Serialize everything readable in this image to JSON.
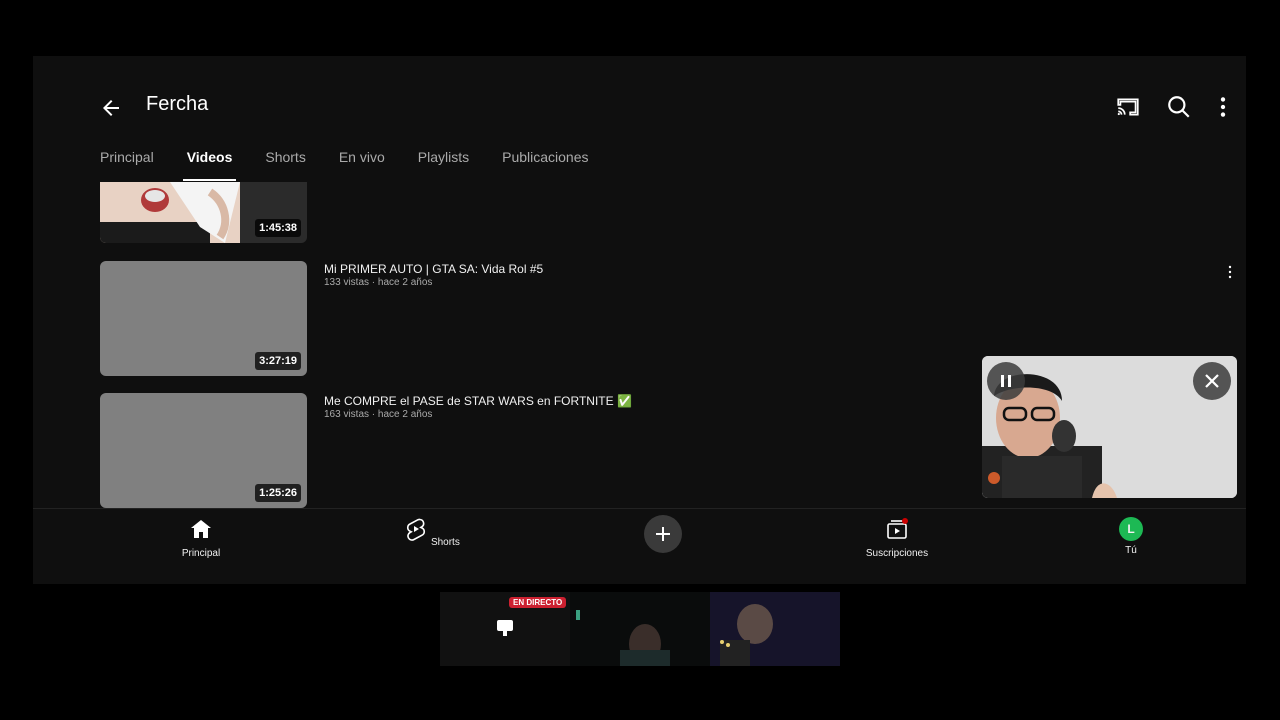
{
  "channel": {
    "name": "Fercha"
  },
  "tabs": [
    {
      "label": "Principal",
      "active": false
    },
    {
      "label": "Videos",
      "active": true
    },
    {
      "label": "Shorts",
      "active": false
    },
    {
      "label": "En vivo",
      "active": false
    },
    {
      "label": "Playlists",
      "active": false
    },
    {
      "label": "Publicaciones",
      "active": false
    }
  ],
  "videos": [
    {
      "duration": "1:45:38"
    },
    {
      "title": "Mi PRIMER AUTO | GTA SA: Vida Rol #5",
      "meta": "133 vistas · hace 2 años",
      "duration": "3:27:19"
    },
    {
      "title": "Me COMPRE el PASE de STAR WARS en FORTNITE ✅",
      "meta": "163 vistas · hace 2 años",
      "duration": "1:25:26"
    }
  ],
  "nav": {
    "home": "Principal",
    "shorts": "Shorts",
    "subs": "Suscripciones",
    "you": "Tú",
    "avatar_letter": "L"
  },
  "overlay": {
    "live_badge": "EN DIRECTO"
  },
  "colors": {
    "accent_live": "#cc0000",
    "avatar": "#1db954"
  }
}
